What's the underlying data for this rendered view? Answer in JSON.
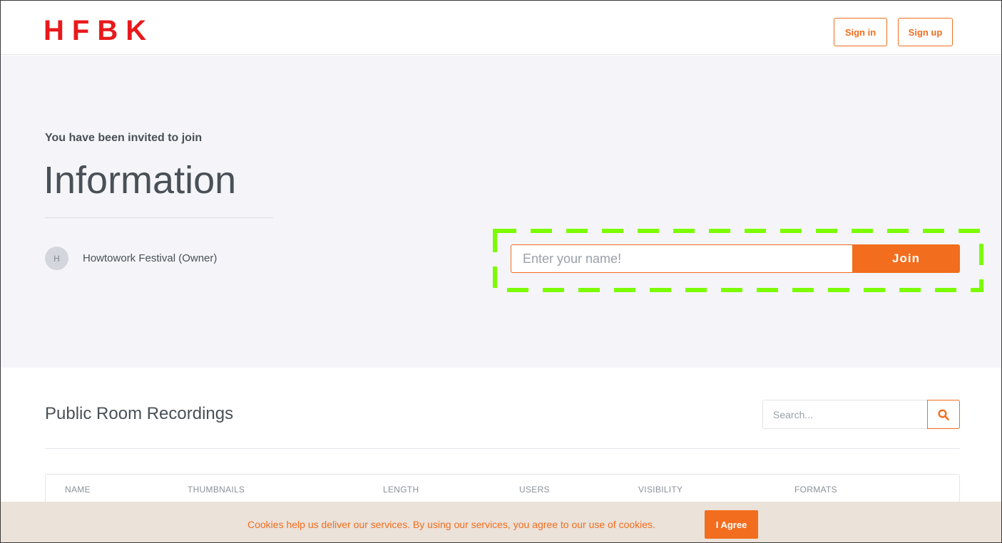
{
  "header": {
    "logo": "HFBK",
    "sign_in_label": "Sign in",
    "sign_up_label": "Sign up"
  },
  "hero": {
    "invited_text": "You have been invited to join",
    "room_name": "Information",
    "owner": {
      "avatar_initial": "H",
      "name": "Howtowork Festival (Owner)"
    },
    "join_form": {
      "name_placeholder": "Enter your name!",
      "join_label": "Join"
    }
  },
  "recordings": {
    "title": "Public Room Recordings",
    "search_placeholder": "Search...",
    "columns": [
      "NAME",
      "THUMBNAILS",
      "LENGTH",
      "USERS",
      "VISIBILITY",
      "FORMATS"
    ]
  },
  "cookie_banner": {
    "text": "Cookies help us deliver our services. By using our services, you agree to our use of cookies.",
    "agree_label": "I Agree"
  },
  "colors": {
    "accent": "#f26d1d",
    "logo": "#e8191c",
    "hero_bg": "#f5f5f9",
    "highlight": "#7cfc00",
    "cookie_bg": "#ebe2da"
  },
  "icons": {
    "search": "search-icon"
  }
}
